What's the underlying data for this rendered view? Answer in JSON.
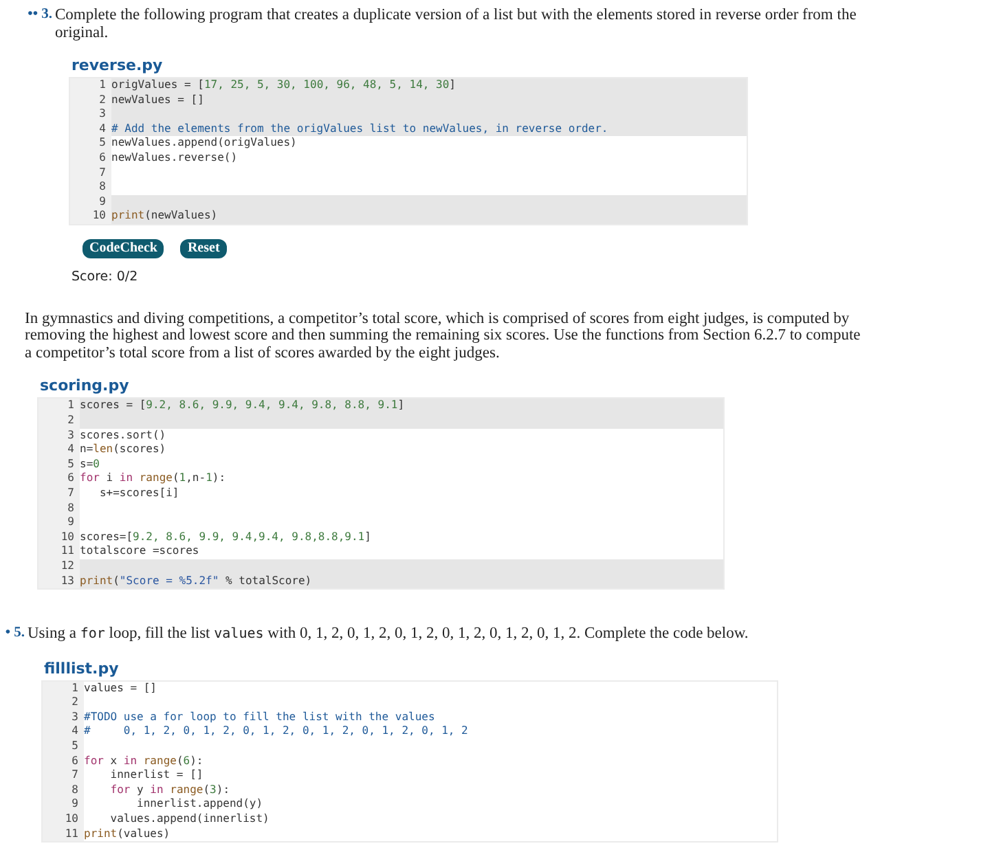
{
  "sections": [
    {
      "kind": "exercise",
      "bullets": "••",
      "number": "3.",
      "prompt": [
        {
          "text": "Complete the following program that creates a duplicate version of a list but with the elements stored in reverse order from the original.",
          "kind": "text"
        }
      ],
      "file": {
        "name": "reverse.py",
        "lines": [
          {
            "number": "1",
            "readonly": true,
            "code": [
              {
                "text": "origValues = [",
                "kind": "plain"
              },
              {
                "text": "17, 25, 5, 30, 100, 96, 48, 5, 14, 30",
                "kind": "number"
              },
              {
                "text": "]",
                "kind": "plain"
              }
            ]
          },
          {
            "number": "2",
            "readonly": true,
            "code": [
              {
                "text": "newValues = []",
                "kind": "plain"
              }
            ]
          },
          {
            "number": "3",
            "readonly": true
          },
          {
            "number": "4",
            "readonly": true,
            "code": [
              {
                "text": "# Add the elements from the origValues list to newValues, in reverse order.",
                "kind": "comment"
              }
            ]
          },
          {
            "number": "5",
            "readonly": false,
            "code": [
              {
                "text": "newValues.append(origValues)",
                "kind": "plain"
              }
            ]
          },
          {
            "number": "6",
            "readonly": false,
            "code": [
              {
                "text": "newValues.reverse()",
                "kind": "plain"
              }
            ]
          },
          {
            "number": "7",
            "readonly": false
          },
          {
            "number": "8",
            "readonly": false
          },
          {
            "number": "9",
            "readonly": true
          },
          {
            "number": "10",
            "readonly": true,
            "code": [
              {
                "text": "print",
                "kind": "builtin"
              },
              {
                "text": "(newValues)",
                "kind": "plain"
              }
            ]
          }
        ]
      },
      "buttons": [
        "CodeCheck",
        "Reset"
      ],
      "score": "Score: 0/2"
    },
    {
      "kind": "paragraph",
      "prompt": [
        {
          "text": "In gymnastics and diving competitions, a competitor’s total score, which is comprised of scores from eight judges, is computed by removing the highest and lowest score and then summing the remaining six scores. Use the functions from Section 6.2.7 to compute a competitor’s total score from a list of scores awarded by the eight judges.",
          "kind": "text"
        }
      ],
      "file": {
        "name": "scoring.py",
        "lines": [
          {
            "number": "1",
            "readonly": true,
            "code": [
              {
                "text": "scores = [",
                "kind": "plain"
              },
              {
                "text": "9.2, 8.6, 9.9, 9.4, 9.4, 9.8, 8.8, 9.1",
                "kind": "number"
              },
              {
                "text": "]",
                "kind": "plain"
              }
            ]
          },
          {
            "number": "2",
            "readonly": true
          },
          {
            "number": "3",
            "readonly": false,
            "code": [
              {
                "text": "scores.sort()",
                "kind": "plain"
              }
            ]
          },
          {
            "number": "4",
            "readonly": false,
            "code": [
              {
                "text": "n=",
                "kind": "plain"
              },
              {
                "text": "len",
                "kind": "builtin"
              },
              {
                "text": "(scores)",
                "kind": "plain"
              }
            ]
          },
          {
            "number": "5",
            "readonly": false,
            "code": [
              {
                "text": "s=",
                "kind": "plain"
              },
              {
                "text": "0",
                "kind": "number"
              }
            ]
          },
          {
            "number": "6",
            "readonly": false,
            "code": [
              {
                "text": "for",
                "kind": "keyword"
              },
              {
                "text": " i ",
                "kind": "plain"
              },
              {
                "text": "in",
                "kind": "keyword"
              },
              {
                "text": " range",
                "kind": "builtin"
              },
              {
                "text": "(",
                "kind": "plain"
              },
              {
                "text": "1",
                "kind": "number"
              },
              {
                "text": ",n-",
                "kind": "plain"
              },
              {
                "text": "1",
                "kind": "number"
              },
              {
                "text": "):",
                "kind": "plain"
              }
            ]
          },
          {
            "number": "7",
            "readonly": false,
            "code": [
              {
                "text": "   s+=scores[i]",
                "kind": "plain"
              }
            ]
          },
          {
            "number": "8",
            "readonly": false
          },
          {
            "number": "9",
            "readonly": false
          },
          {
            "number": "10",
            "readonly": false,
            "code": [
              {
                "text": "scores=[",
                "kind": "plain"
              },
              {
                "text": "9.2, 8.6, 9.9, 9.4,9.4, 9.8,8.8,9.1",
                "kind": "number"
              },
              {
                "text": "]",
                "kind": "plain"
              }
            ]
          },
          {
            "number": "11",
            "readonly": false,
            "code": [
              {
                "text": "totalscore =scores",
                "kind": "plain"
              }
            ]
          },
          {
            "number": "12",
            "readonly": true
          },
          {
            "number": "13",
            "readonly": true,
            "code": [
              {
                "text": "print",
                "kind": "builtin"
              },
              {
                "text": "(",
                "kind": "plain"
              },
              {
                "text": "\"Score = %5.2f\"",
                "kind": "string"
              },
              {
                "text": " % totalScore)",
                "kind": "plain"
              }
            ]
          }
        ]
      }
    },
    {
      "kind": "exercise",
      "bullets": "•",
      "number": "5.",
      "prompt": [
        {
          "text": "Using a ",
          "kind": "text"
        },
        {
          "text": "for",
          "kind": "code"
        },
        {
          "text": " loop, fill the list ",
          "kind": "text"
        },
        {
          "text": "values",
          "kind": "code"
        },
        {
          "text": " with 0, 1, 2, 0, 1, 2, 0, 1, 2, 0, 1, 2, 0, 1, 2, 0, 1, 2. Complete the code below.",
          "kind": "text"
        }
      ],
      "file": {
        "name": "filllist.py",
        "lines": [
          {
            "number": "1",
            "readonly": false,
            "code": [
              {
                "text": "values = []",
                "kind": "plain"
              }
            ]
          },
          {
            "number": "2",
            "readonly": false
          },
          {
            "number": "3",
            "readonly": false,
            "code": [
              {
                "text": "#TODO use a for loop to fill the list with the values",
                "kind": "comment"
              }
            ]
          },
          {
            "number": "4",
            "readonly": false,
            "code": [
              {
                "text": "#     0, 1, 2, 0, 1, 2, 0, 1, 2, 0, 1, 2, 0, 1, 2, 0, 1, 2",
                "kind": "comment"
              }
            ]
          },
          {
            "number": "5",
            "readonly": false
          },
          {
            "number": "6",
            "readonly": false,
            "code": [
              {
                "text": "for",
                "kind": "keyword"
              },
              {
                "text": " x ",
                "kind": "plain"
              },
              {
                "text": "in",
                "kind": "keyword"
              },
              {
                "text": " range",
                "kind": "builtin"
              },
              {
                "text": "(",
                "kind": "plain"
              },
              {
                "text": "6",
                "kind": "number"
              },
              {
                "text": "):",
                "kind": "plain"
              }
            ]
          },
          {
            "number": "7",
            "readonly": false,
            "code": [
              {
                "text": "    innerlist = []",
                "kind": "plain"
              }
            ]
          },
          {
            "number": "8",
            "readonly": false,
            "code": [
              {
                "text": "    for",
                "kind": "keyword"
              },
              {
                "text": " y ",
                "kind": "plain"
              },
              {
                "text": "in",
                "kind": "keyword"
              },
              {
                "text": " range",
                "kind": "builtin"
              },
              {
                "text": "(",
                "kind": "plain"
              },
              {
                "text": "3",
                "kind": "number"
              },
              {
                "text": "):",
                "kind": "plain"
              }
            ]
          },
          {
            "number": "9",
            "readonly": false,
            "code": [
              {
                "text": "        innerlist.append(y)",
                "kind": "plain"
              }
            ]
          },
          {
            "number": "10",
            "readonly": false,
            "code": [
              {
                "text": "    values.append(innerlist)",
                "kind": "plain"
              }
            ]
          },
          {
            "number": "11",
            "readonly": false,
            "code": [
              {
                "text": "print",
                "kind": "builtin"
              },
              {
                "text": "(values)",
                "kind": "plain"
              }
            ]
          }
        ]
      }
    }
  ]
}
